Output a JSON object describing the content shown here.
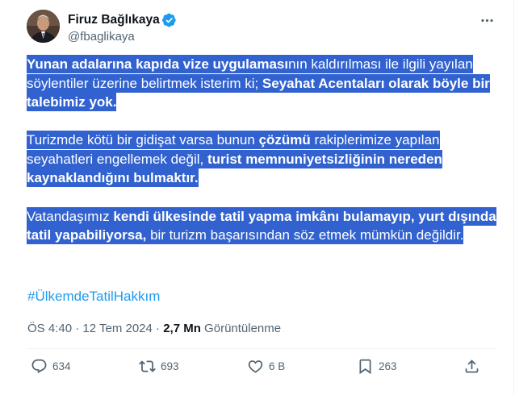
{
  "author": {
    "name": "Firuz Bağlıkaya",
    "handle": "@fbaglikaya",
    "verified": true,
    "avatar_icon": "profile-photo"
  },
  "tweet": {
    "p1": {
      "s1": "Yunan adalarına kapıda vize uygulaması",
      "s2": "nın kaldırılması ile ilgili yayılan söylentiler üzerine belirtmek isterim ki; ",
      "s3": "Seyahat Acentaları olarak böyle bir talebimiz yok."
    },
    "p2": {
      "s1": "Turizmde kötü bir gidişat varsa bunun ",
      "s2": "çözümü",
      "s3": " rakiplerimize yapılan seyahatleri engellemek değil, ",
      "s4": "turist memnuniyetsizliğinin nereden kaynaklandığını bulmaktır."
    },
    "p3": {
      "s1": "Vatandaşımız ",
      "s2": "kendi ülkesinde tatil yapma imkânı bulamayıp, yurt dışında tatil yapabiliyorsa,",
      "s3": " bir turizm başarısından söz etmek mümkün değildir."
    },
    "hashtag": "#ÜlkemdeTatilHakkım"
  },
  "meta": {
    "time": "ÖS 4:40",
    "separator": " · ",
    "date": "12 Tem 2024",
    "views_count": "2,7 Mn",
    "views_label": " Görüntülenme"
  },
  "actions": {
    "replies": "634",
    "reposts": "693",
    "likes": "6 B",
    "bookmarks": "263"
  },
  "colors": {
    "highlight": "#3162cf",
    "link": "#1d9bf0",
    "verified": "#1d9bf0",
    "muted": "#536471"
  }
}
